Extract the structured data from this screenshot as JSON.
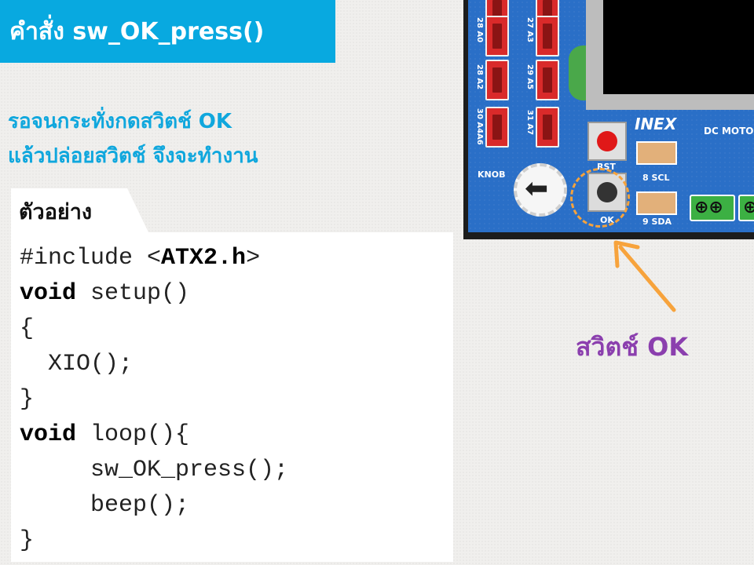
{
  "title": "คำสั่ง sw_OK_press()",
  "description": {
    "line1": "รอจนกระทั่งกดสวิตช์ OK",
    "line2": "แล้วปล่อยสวิตช์ จึงจะทำงาน"
  },
  "example": {
    "label": "ตัวอย่าง"
  },
  "code_lines": [
    {
      "pre": "#include <",
      "bold": "ATX2.h",
      "post": ">"
    },
    {
      "pre": "",
      "bold": "void",
      "post": " setup()"
    },
    {
      "pre": "{",
      "bold": "",
      "post": ""
    },
    {
      "pre": "  XIO();",
      "bold": "",
      "post": ""
    },
    {
      "pre": "}",
      "bold": "",
      "post": ""
    },
    {
      "pre": "",
      "bold": "void",
      "post": " loop(){"
    },
    {
      "pre": "     sw_OK_press();",
      "bold": "",
      "post": ""
    },
    {
      "pre": "     beep();",
      "bold": "",
      "post": ""
    },
    {
      "pre": "}",
      "bold": "",
      "post": ""
    }
  ],
  "board": {
    "pin_labels": [
      "28 A0",
      "27 A3",
      "28 A2",
      "29 A5",
      "30 A4",
      "31 A7",
      "A6"
    ],
    "knob_label": "KNOB",
    "rst_label": "RST",
    "ok_label": "OK",
    "scl_label": "8 SCL",
    "sda_label": "9 SDA",
    "brand": "INEX",
    "dc_motor_label": "DC MOTOR",
    "terminal_symbols": "⊕⊕"
  },
  "callout": {
    "caption": "สวิตช์ OK"
  },
  "colors": {
    "title_bg": "#08a9e0",
    "description_text": "#10a7dd",
    "caption_text": "#8b3fae",
    "callout_orange": "#f7a33c"
  }
}
